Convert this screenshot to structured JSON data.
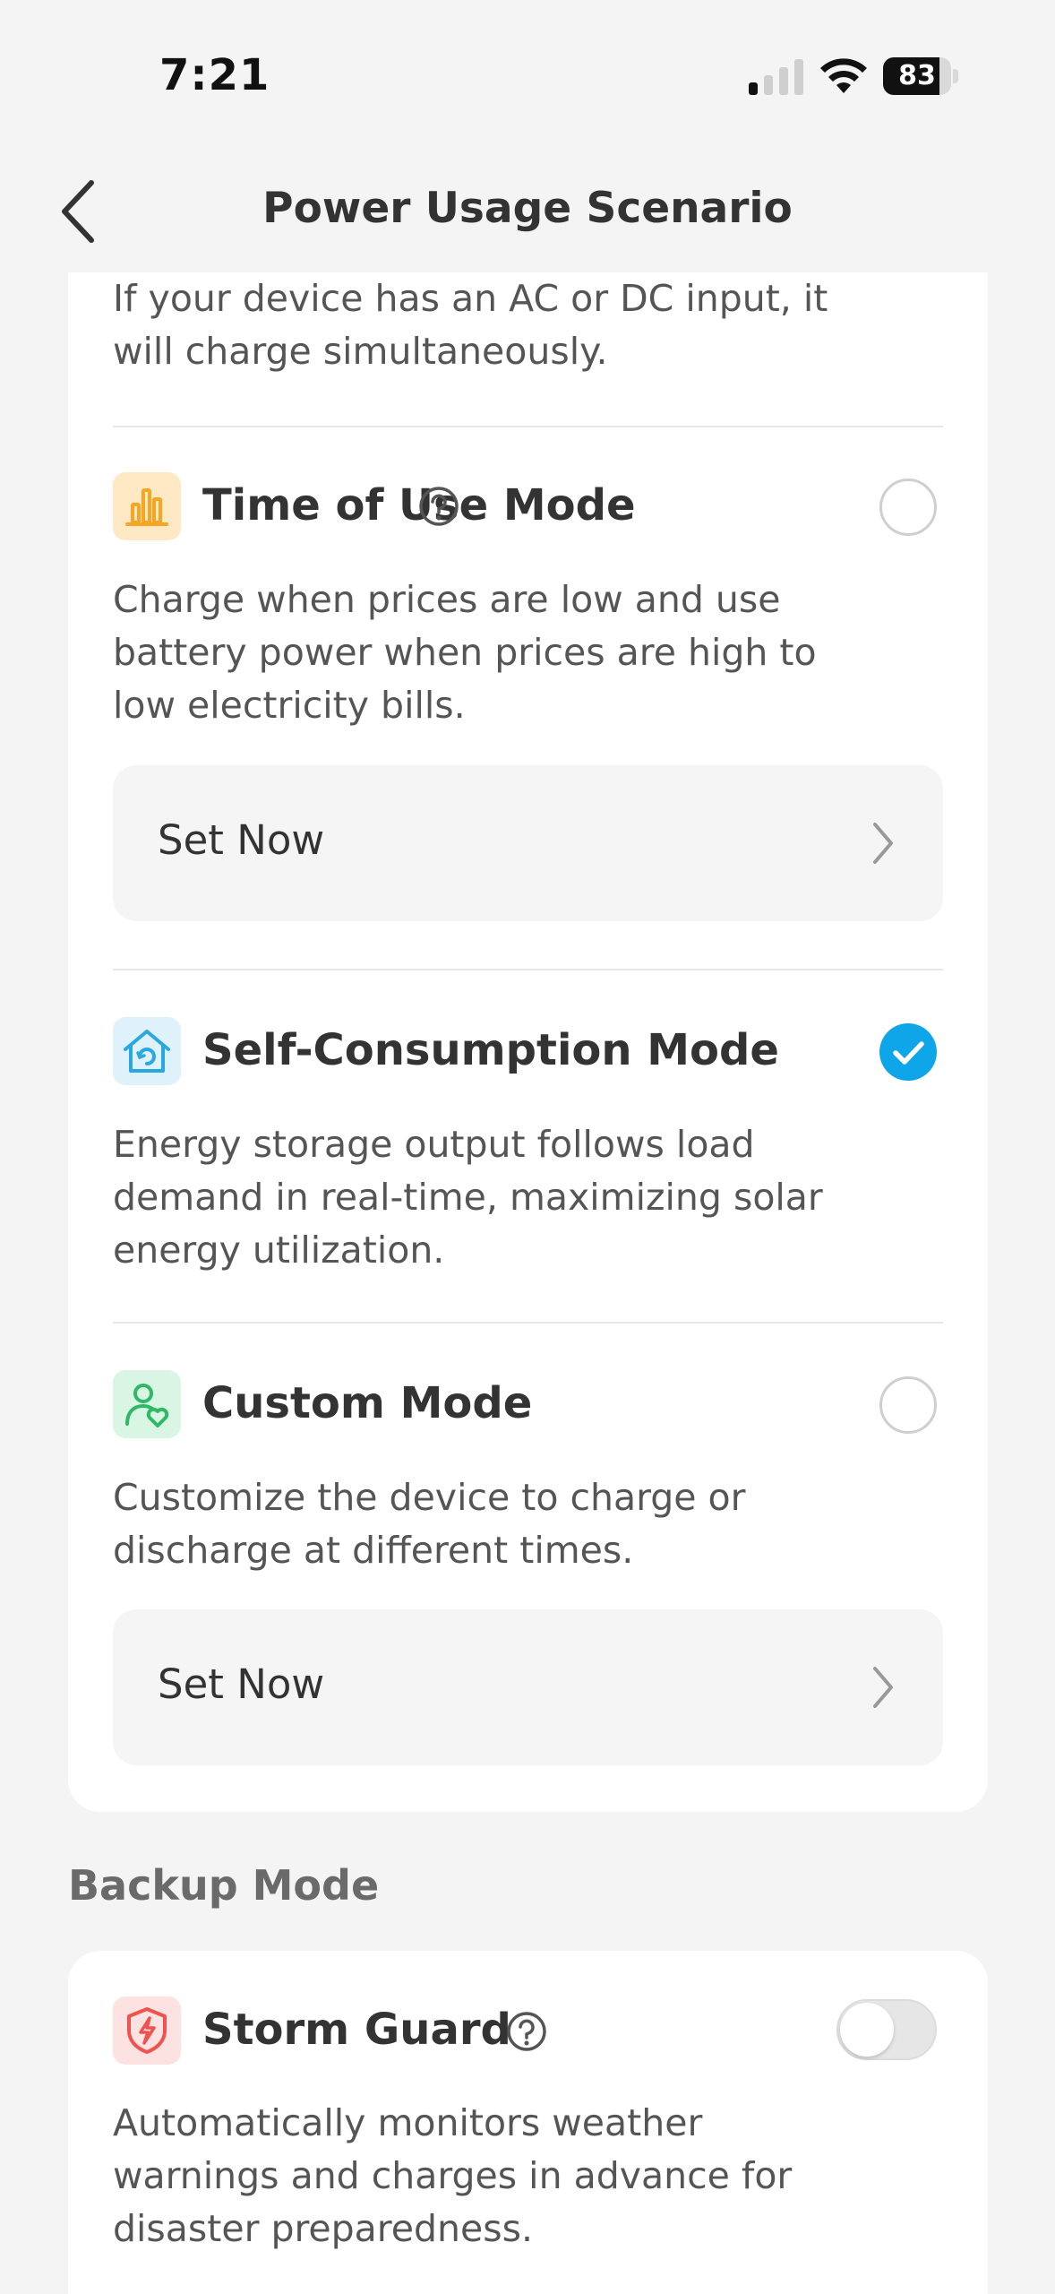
{
  "status_bar": {
    "time": "7:21",
    "battery_level": "83",
    "battery_fraction": 0.83
  },
  "nav": {
    "title": "Power Usage Scenario",
    "back_icon": "chevron-left-icon"
  },
  "modes_card": {
    "top_description": "If your device has an AC or DC input, it\nwill charge simultaneously.",
    "modes": [
      {
        "title": "Time of Use Mode",
        "icon": "bar-chart-icon",
        "icon_color": "#f5a623",
        "icon_bg": "#ffe9c4",
        "has_help": true,
        "selected": false,
        "description": "Charge when prices are low and use\nbattery power when prices are high to\nlow electricity bills.",
        "action_label": "Set Now"
      },
      {
        "title": "Self-Consumption Mode",
        "icon": "solar-home-icon",
        "icon_color": "#29a9e0",
        "icon_bg": "#dff2fb",
        "has_help": false,
        "selected": true,
        "description": "Energy storage output follows load\ndemand in real-time, maximizing solar\nenergy utilization."
      },
      {
        "title": "Custom Mode",
        "icon": "user-heart-icon",
        "icon_color": "#2fb866",
        "icon_bg": "#d9f5e4",
        "has_help": false,
        "selected": false,
        "description": "Customize the device to charge or\ndischarge at different times.",
        "action_label": "Set Now"
      }
    ]
  },
  "backup_section": {
    "title": "Backup Mode",
    "item": {
      "title": "Storm Guard",
      "icon": "storm-shield-icon",
      "icon_color": "#ef5350",
      "icon_bg": "#fde2e2",
      "has_help": true,
      "enabled": false,
      "description": "Automatically monitors weather\nwarnings and charges in advance for\ndisaster preparedness."
    }
  },
  "colors": {
    "accent": "#0ea5e9",
    "background": "#f4f4f5"
  }
}
